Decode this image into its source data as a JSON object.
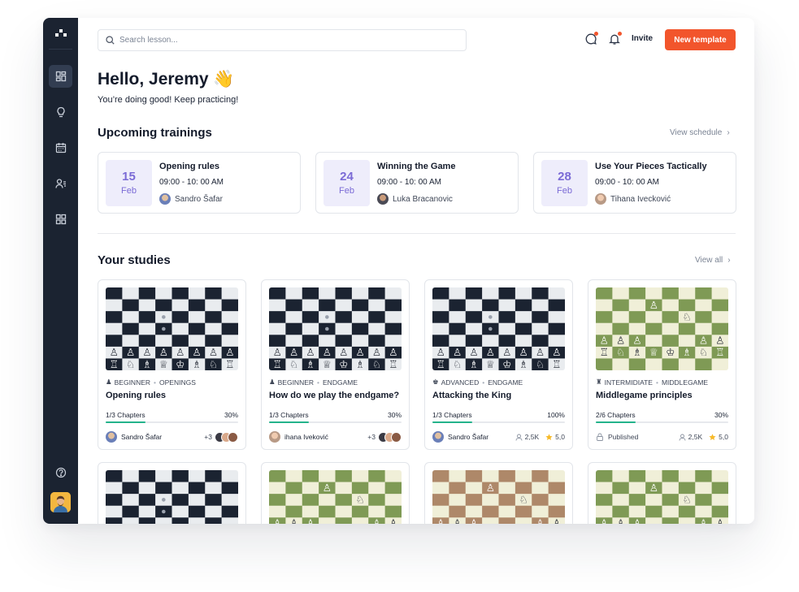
{
  "search": {
    "placeholder": "Search lesson..."
  },
  "header": {
    "invite_label": "Invite",
    "new_template_label": "New template"
  },
  "greeting": {
    "title": "Hello, Jeremy 👋",
    "subtitle": "You’re doing good! Keep practicing!"
  },
  "trainings": {
    "title": "Upcoming trainings",
    "link": "View schedule",
    "items": [
      {
        "day": "15",
        "month": "Feb",
        "title": "Opening rules",
        "time": "09:00 - 10: 00 AM",
        "person": "Sandro Šafar"
      },
      {
        "day": "24",
        "month": "Feb",
        "title": "Winning the Game",
        "time": "09:00 - 10: 00 AM",
        "person": "Luka Bracanovic"
      },
      {
        "day": "28",
        "month": "Feb",
        "title": "Use Your Pieces Tactically",
        "time": "09:00 - 10: 00 AM",
        "person": "Tihana Ivecković"
      }
    ]
  },
  "studies": {
    "title": "Your studies",
    "link": "View all",
    "items": [
      {
        "level": "BEGINNER",
        "topic": "OPENINGS",
        "title": "Opening rules",
        "chapters": "1/3 Chapters",
        "percent_label": "30%",
        "progress": 0.3,
        "author": "Sandro Šafar",
        "extra": "+3"
      },
      {
        "level": "BEGINNER",
        "topic": "ENDGAME",
        "title": "How do we play the endgame?",
        "chapters": "1/3 Chapters",
        "percent_label": "30%",
        "progress": 0.3,
        "author": "ihana Iveković",
        "extra": "+3"
      },
      {
        "level": "ADVANCED",
        "topic": "ENDGAME",
        "title": "Attacking the King",
        "chapters": "1/3 Chapters",
        "percent_label": "100%",
        "progress": 0.3,
        "author": "Sandro Šafar",
        "students": "2,5K",
        "rating": "5,0"
      },
      {
        "level": "INTERMIDIATE",
        "topic": "MIDDLEGAME",
        "title": "Middlegame principles",
        "chapters": "2/6 Chapters",
        "percent_label": "30%",
        "progress": 0.3,
        "status": "Published",
        "students": "2,5K",
        "rating": "5,0"
      }
    ]
  },
  "colors": {
    "accent": "#f2552c",
    "sidebar": "#1b2331",
    "date_bg": "#eeedfb",
    "date_text": "#7b6bd6",
    "progress": "#24b38b",
    "board_dark_navy": "#1b2331",
    "board_light_grey": "#e9ecef",
    "board_dark_green": "#7f9a55",
    "board_light_cream": "#f0efd8",
    "board_dark_brown": "#ae8869"
  },
  "icons": {
    "sidebar": [
      "logo-icon",
      "dashboard-icon",
      "lightbulb-icon",
      "calendar-icon",
      "users-icon",
      "grid-icon",
      "help-icon"
    ],
    "header": [
      "chat-icon",
      "bell-icon",
      "search-icon"
    ]
  }
}
